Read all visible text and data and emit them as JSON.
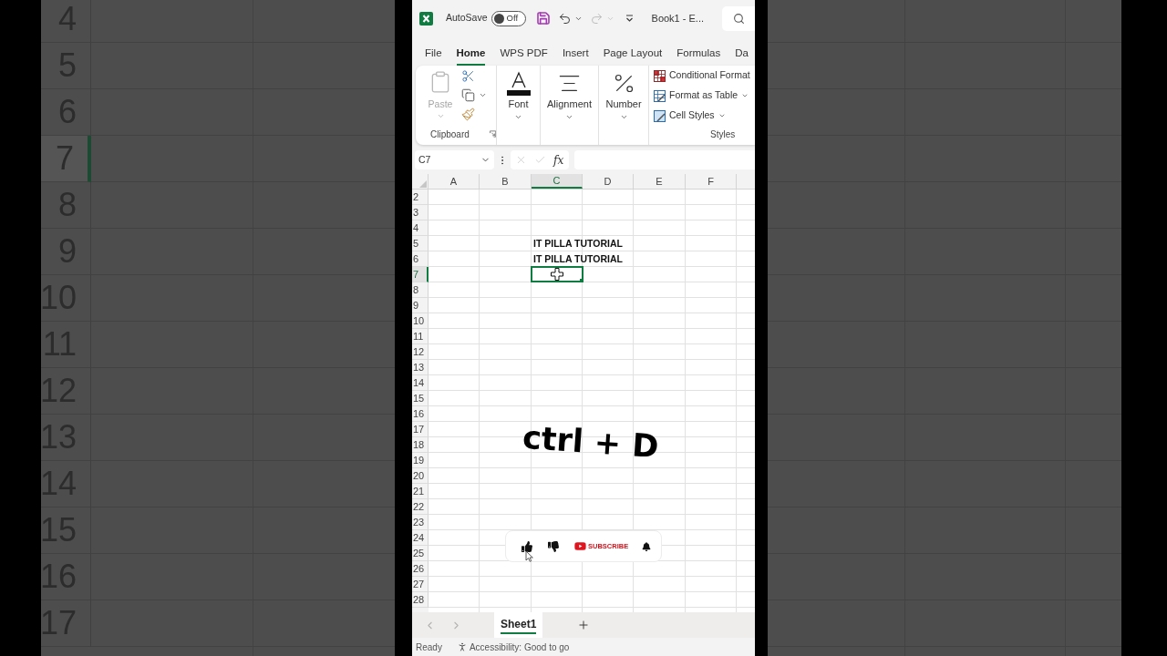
{
  "backdrop": {
    "row_numbers": [
      {
        "label": "4",
        "selected": false
      },
      {
        "label": "5",
        "selected": false
      },
      {
        "label": "6",
        "selected": false
      },
      {
        "label": "7",
        "selected": true
      },
      {
        "label": "8",
        "selected": false
      },
      {
        "label": "9",
        "selected": false
      },
      {
        "label": "10",
        "selected": false
      },
      {
        "label": "11",
        "selected": false
      },
      {
        "label": "12",
        "selected": false
      },
      {
        "label": "13",
        "selected": false
      },
      {
        "label": "14",
        "selected": false
      },
      {
        "label": "15",
        "selected": false
      },
      {
        "label": "16",
        "selected": false
      },
      {
        "label": "17",
        "selected": false
      }
    ]
  },
  "title_bar": {
    "autosave_label": "AutoSave",
    "autosave": {
      "on": false,
      "label": "Off"
    },
    "quick_access": [
      {
        "kind": "save",
        "disabled": false
      },
      {
        "kind": "undo",
        "disabled": false
      },
      {
        "kind": "redo",
        "disabled": true
      },
      {
        "kind": "customize",
        "disabled": false
      }
    ],
    "title": "Book1 - E..."
  },
  "ribbon_tabs": [
    {
      "label": "File",
      "selected": false
    },
    {
      "label": "Home",
      "selected": true
    },
    {
      "label": "WPS PDF",
      "selected": false
    },
    {
      "label": "Insert",
      "selected": false
    },
    {
      "label": "Page Layout",
      "selected": false
    },
    {
      "label": "Formulas",
      "selected": false
    },
    {
      "label": "Da",
      "selected": false
    }
  ],
  "ribbon": {
    "groups": [
      {
        "kind": "clipboard",
        "label": "Clipboard",
        "paste": {
          "label": "Paste",
          "disabled": true
        }
      },
      {
        "kind": "font",
        "label": "Font"
      },
      {
        "kind": "alignment",
        "label": "Alignment"
      },
      {
        "kind": "number",
        "label": "Number"
      },
      {
        "kind": "styles",
        "label": "Styles",
        "items": [
          {
            "kind": "conditional",
            "label": "Conditional Format",
            "dropdown": false
          },
          {
            "kind": "table",
            "label": "Format as Table",
            "dropdown": true
          },
          {
            "kind": "cell",
            "label": "Cell Styles",
            "dropdown": true
          }
        ]
      }
    ]
  },
  "formula_bar": {
    "name_box": "C7",
    "function_label": "fx"
  },
  "sheet": {
    "columns": [
      {
        "label": "A",
        "selected": false
      },
      {
        "label": "B",
        "selected": false
      },
      {
        "label": "C",
        "selected": true
      },
      {
        "label": "D",
        "selected": false
      },
      {
        "label": "E",
        "selected": false
      },
      {
        "label": "F",
        "selected": false
      }
    ],
    "rows": [
      {
        "label": "2",
        "selected": false
      },
      {
        "label": "3",
        "selected": false
      },
      {
        "label": "4",
        "selected": false
      },
      {
        "label": "5",
        "selected": false,
        "cells": {
          "C": "IT PILLA TUTORIAL"
        }
      },
      {
        "label": "6",
        "selected": false,
        "cells": {
          "C": "IT PILLA TUTORIAL"
        }
      },
      {
        "label": "7",
        "selected": true
      },
      {
        "label": "8",
        "selected": false
      },
      {
        "label": "9",
        "selected": false
      },
      {
        "label": "10",
        "selected": false
      },
      {
        "label": "11",
        "selected": false
      },
      {
        "label": "12",
        "selected": false
      },
      {
        "label": "13",
        "selected": false
      },
      {
        "label": "14",
        "selected": false
      },
      {
        "label": "15",
        "selected": false
      },
      {
        "label": "16",
        "selected": false
      },
      {
        "label": "17",
        "selected": false
      },
      {
        "label": "18",
        "selected": false
      },
      {
        "label": "19",
        "selected": false
      },
      {
        "label": "20",
        "selected": false
      },
      {
        "label": "21",
        "selected": false
      },
      {
        "label": "22",
        "selected": false
      },
      {
        "label": "23",
        "selected": false
      },
      {
        "label": "24",
        "selected": false
      },
      {
        "label": "25",
        "selected": false
      },
      {
        "label": "26",
        "selected": false
      },
      {
        "label": "27",
        "selected": false
      },
      {
        "label": "28",
        "selected": false
      }
    ]
  },
  "caption": "ctrl + D",
  "subscribe_overlay": {
    "label": "SUBSCRIBE"
  },
  "sheet_tabs": [
    {
      "label": "Sheet1",
      "selected": true
    }
  ],
  "status_bar": {
    "status": "Ready",
    "accessibility": "Accessibility: Good to go"
  }
}
